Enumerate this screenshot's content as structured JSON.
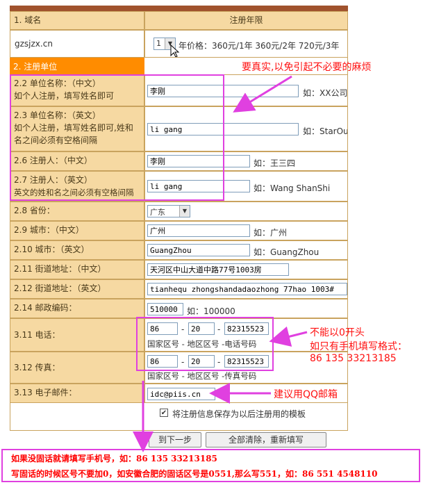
{
  "header": {
    "col1": "1. 域名",
    "col2": "注册年限"
  },
  "domain": {
    "name": "gzsjzx.cn",
    "years": "1",
    "price": "年价格：360元/1年 360元/2年 720元/3年"
  },
  "section2": "2. 注册单位",
  "rows": {
    "r22": {
      "label1": "2.2 单位名称：（中文）",
      "label2": "如个人注册，填写姓名即可",
      "value": "李刚",
      "hint": "如：XX公司"
    },
    "r23": {
      "label1": "2.3 单位名称：（英文）",
      "label2": "如个人注册，填写姓名即可,姓和",
      "label3": "名之间必须有空格间隔",
      "value": "li gang",
      "hint": "如：StarOu"
    },
    "r26": {
      "label1": "2.6 注册人：（中文）",
      "value": "李刚",
      "hint": "如：王三四"
    },
    "r27": {
      "label1": "2.7 注册人：（英文）",
      "label2": "英文的姓和名之间必须有空格间隔",
      "value": "li gang",
      "hint": "如：Wang ShanShi"
    },
    "r28": {
      "label1": "2.8 省份：",
      "value": "广东"
    },
    "r29": {
      "label1": "2.9 城市：（中文）",
      "value": "广州",
      "hint": "如：广州"
    },
    "r210": {
      "label1": "2.10 城市：（英文）",
      "value": "GuangZhou",
      "hint": "如：GuangZhou"
    },
    "r211": {
      "label1": "2.11 街道地址：（中文）",
      "value": "天河区中山大道中路77号1003房"
    },
    "r212": {
      "label1": "2.12 街道地址：（英文）",
      "value": "tianhequ zhongshandadaozhong 77hao 1003#"
    },
    "r214": {
      "label1": "2.14 邮政编码：",
      "value": "510000",
      "hint": "如：100000"
    },
    "r311": {
      "label1": "3.11 电话：",
      "country": "86",
      "area": "20",
      "number": "82315523",
      "caption": "国家区号 - 地区区号 -电话号码"
    },
    "r312": {
      "label1": "3.12 传真：",
      "country": "86",
      "area": "20",
      "number": "82315523",
      "caption": "国家区号 - 地区区号 -传真号码"
    },
    "r313": {
      "label1": "3.13 电子邮件：",
      "value": "idc@piis.cn"
    }
  },
  "checkbox_label": "将注册信息保存为以后注册用的模板",
  "buttons": {
    "next": "到下一步",
    "reset": "全部清除，重新填写"
  },
  "annotations": {
    "real_info": "要真实,以免引起不必要的麻烦",
    "phone1": "不能以0开头",
    "phone2": "如只有手机填写格式：",
    "phone3": "86 135 33213185",
    "email": "建议用QQ邮箱",
    "bottom1": "如果没固话就请填写手机号，如：86 135 33213185",
    "bottom2": "写固话的时候区号不要加0，如安徽合肥的固话区号是0551,那么写551，如：86 551 4548110"
  },
  "colors": {
    "accent": "#ff8c00",
    "label_bg": "#f6d9a2",
    "annotation": "#ff1010",
    "highlight": "#e040e0"
  }
}
